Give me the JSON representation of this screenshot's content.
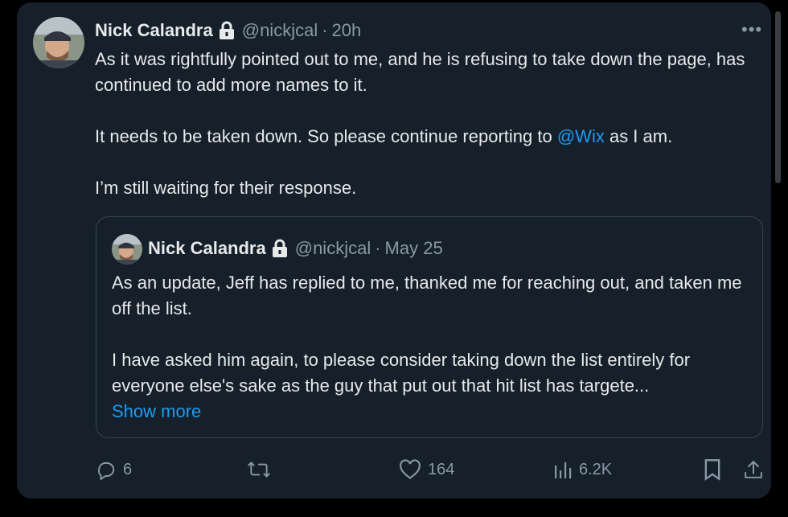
{
  "tweet": {
    "author_name": "Nick Calandra",
    "handle": "@nickjcal",
    "time": "20h",
    "separator": "·",
    "more_label": "•••",
    "text_line1": "As it was rightfully pointed out to me, and he is refusing to take down the page, has continued to add more names to it.",
    "text_line2_pre": "It needs to be taken down. So please continue reporting to ",
    "text_line2_mention": "@Wix",
    "text_line2_post": " as I am.",
    "text_line3": "I’m still waiting for their response."
  },
  "quote": {
    "author_name": "Nick Calandra",
    "handle": "@nickjcal",
    "separator": "·",
    "time": "May 25",
    "para1": "As an update, Jeff has replied to me, thanked me for reaching out, and taken me off the list.",
    "para2": "I have asked him again, to please consider taking down the list entirely for everyone else's sake as the guy that put out that hit list has targete...",
    "show_more": "Show more"
  },
  "actions": {
    "replies": "6",
    "retweets": "",
    "likes": "164",
    "views": "6.2K"
  },
  "colors": {
    "background": "#15202b",
    "accent": "#1d9bf0",
    "muted": "#8b98a5"
  }
}
